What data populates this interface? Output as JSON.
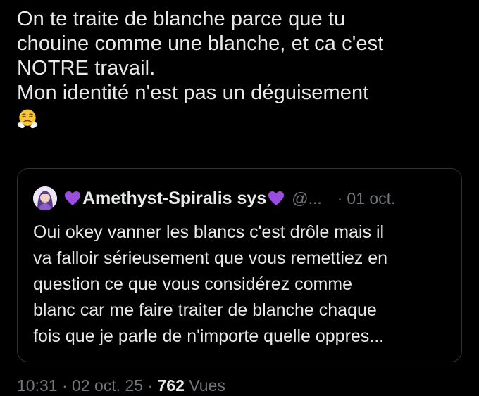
{
  "tweet": {
    "lines": [
      "On te traite de blanche parce que tu",
      "chouine comme une blanche, et ca c'est",
      "NOTRE travail.",
      "Mon identité n'est pas un déguisement"
    ],
    "emoji": "face-with-steam-from-nose"
  },
  "quote": {
    "display_name": "Amethyst-Spiralis sys",
    "name_emoji": "purple-heart",
    "handle": "@...",
    "separator": "·",
    "date": "01 oct.",
    "lines": [
      "Oui okey vanner les blancs c'est drôle mais il",
      "va falloir sérieusement que vous remettiez en",
      "question ce que vous considérez comme",
      "blanc car me faire traiter de blanche chaque",
      "fois que je parle de n'importe quelle oppres..."
    ]
  },
  "meta": {
    "time": "10:31",
    "sep1": "·",
    "date": "02 oct. 25",
    "sep2": "·",
    "views_count": "762",
    "views_label": "Vues"
  },
  "colors": {
    "background": "#000000",
    "text_primary": "#e7e9ea",
    "text_secondary": "#71767b",
    "border": "#2f3336",
    "heart": "#9b4de0"
  }
}
